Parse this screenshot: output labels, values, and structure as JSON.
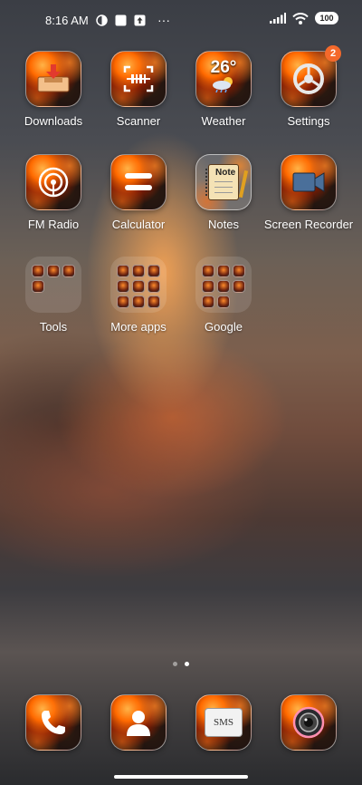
{
  "status_bar": {
    "time": "8:16 AM",
    "more": "···",
    "battery": "100"
  },
  "apps": [
    {
      "id": "downloads",
      "label": "Downloads",
      "icon": "download-tray-icon"
    },
    {
      "id": "scanner",
      "label": "Scanner",
      "icon": "scanner-icon"
    },
    {
      "id": "weather",
      "label": "Weather",
      "icon": "weather-icon",
      "temp": "26°"
    },
    {
      "id": "settings",
      "label": "Settings",
      "icon": "gear-icon",
      "badge": "2"
    },
    {
      "id": "fm-radio",
      "label": "FM Radio",
      "icon": "radio-icon"
    },
    {
      "id": "calculator",
      "label": "Calculator",
      "icon": "calculator-icon"
    },
    {
      "id": "notes",
      "label": "Notes",
      "icon": "notebook-icon",
      "note_text": "Note"
    },
    {
      "id": "screen-recorder",
      "label": "Screen Recorder",
      "icon": "camera-recorder-icon"
    }
  ],
  "folders": [
    {
      "id": "tools",
      "label": "Tools",
      "count": 4
    },
    {
      "id": "more-apps",
      "label": "More apps",
      "count": 9
    },
    {
      "id": "google",
      "label": "Google",
      "count": 8
    }
  ],
  "dock": [
    {
      "id": "phone",
      "icon": "phone-icon"
    },
    {
      "id": "contacts",
      "icon": "contact-icon"
    },
    {
      "id": "messages",
      "icon": "sms-icon",
      "text": "SMS"
    },
    {
      "id": "camera",
      "icon": "camera-lens-icon"
    }
  ],
  "pagination": {
    "pages": 2,
    "current": 2
  },
  "colors": {
    "badge": "#f4692b",
    "accent": "#ff6a00"
  }
}
